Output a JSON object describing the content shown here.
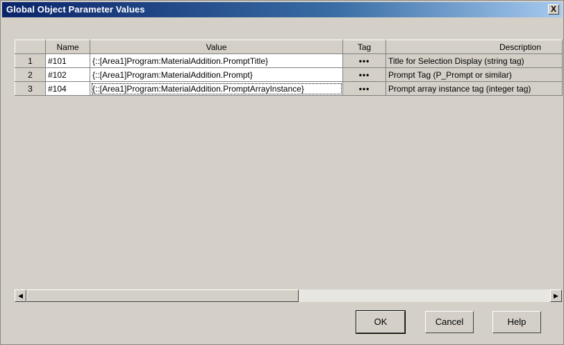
{
  "window": {
    "title": "Global Object Parameter Values",
    "close_glyph": "X"
  },
  "table": {
    "headers": {
      "row": "",
      "name": "Name",
      "value": "Value",
      "tag": "Tag",
      "description": "Description"
    },
    "rows": [
      {
        "num": "1",
        "name": "#101",
        "value": "{::[Area1]Program:MaterialAddition.PromptTitle}",
        "tag": "•••",
        "description": "Title for Selection Display (string tag)"
      },
      {
        "num": "2",
        "name": "#102",
        "value": "{::[Area1]Program:MaterialAddition.Prompt}",
        "tag": "•••",
        "description": "Prompt Tag (P_Prompt or similar)"
      },
      {
        "num": "3",
        "name": "#104",
        "value": "{::[Area1]Program:MaterialAddition.PromptArrayInstance}",
        "tag": "•••",
        "description": "Prompt array instance tag (integer tag)"
      }
    ]
  },
  "scrollbar": {
    "left_arrow": "◀",
    "right_arrow": "▶"
  },
  "buttons": {
    "ok": "OK",
    "cancel": "Cancel",
    "help": "Help"
  },
  "colors": {
    "titlebar_start": "#0a246a",
    "titlebar_end": "#a6caf0",
    "face": "#d4d0c8"
  }
}
